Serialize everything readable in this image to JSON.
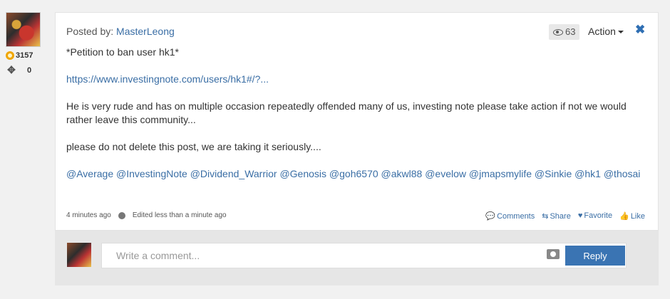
{
  "user": {
    "points": "3157",
    "moves": "0"
  },
  "post": {
    "posted_by_label": "Posted by:",
    "author": "MasterLeong",
    "views": "63",
    "action_label": "Action",
    "close_symbol": "✖",
    "paragraphs": [
      "*Petition to ban user hk1*",
      "https://www.investingnote.com/users/hk1#/?...",
      "He is very rude and has on multiple occasion repeatedly offended many of us, investing note please take action if not we would rather leave this community...",
      "please do not delete this post, we are taking it seriously...."
    ],
    "mentions": [
      "@Average",
      "@InvestingNote",
      "@Dividend_Warrior",
      "@Genosis",
      "@goh6570",
      "@akwl88",
      "@evelow",
      "@jmapsmylife",
      "@Sinkie",
      "@hk1",
      "@thosai"
    ],
    "time_ago": "4 minutes ago",
    "edited": "Edited less than a minute ago",
    "actions": {
      "comments": "Comments",
      "share": "Share",
      "favorite": "Favorite",
      "like": "Like"
    }
  },
  "comment": {
    "placeholder": "Write a comment...",
    "reply_label": "Reply"
  },
  "icons": {
    "badge": "badge-icon",
    "move": "move-icon",
    "eye": "eye-icon",
    "close": "close-icon",
    "globe": "globe-icon",
    "comments": "comment-icon",
    "share": "share-icon",
    "favorite": "heart-icon",
    "like": "thumbs-up-icon",
    "camera": "camera-icon"
  },
  "colors": {
    "link": "#3a6ea5",
    "reply_button": "#3a74b3",
    "badge": "#f0a500"
  }
}
